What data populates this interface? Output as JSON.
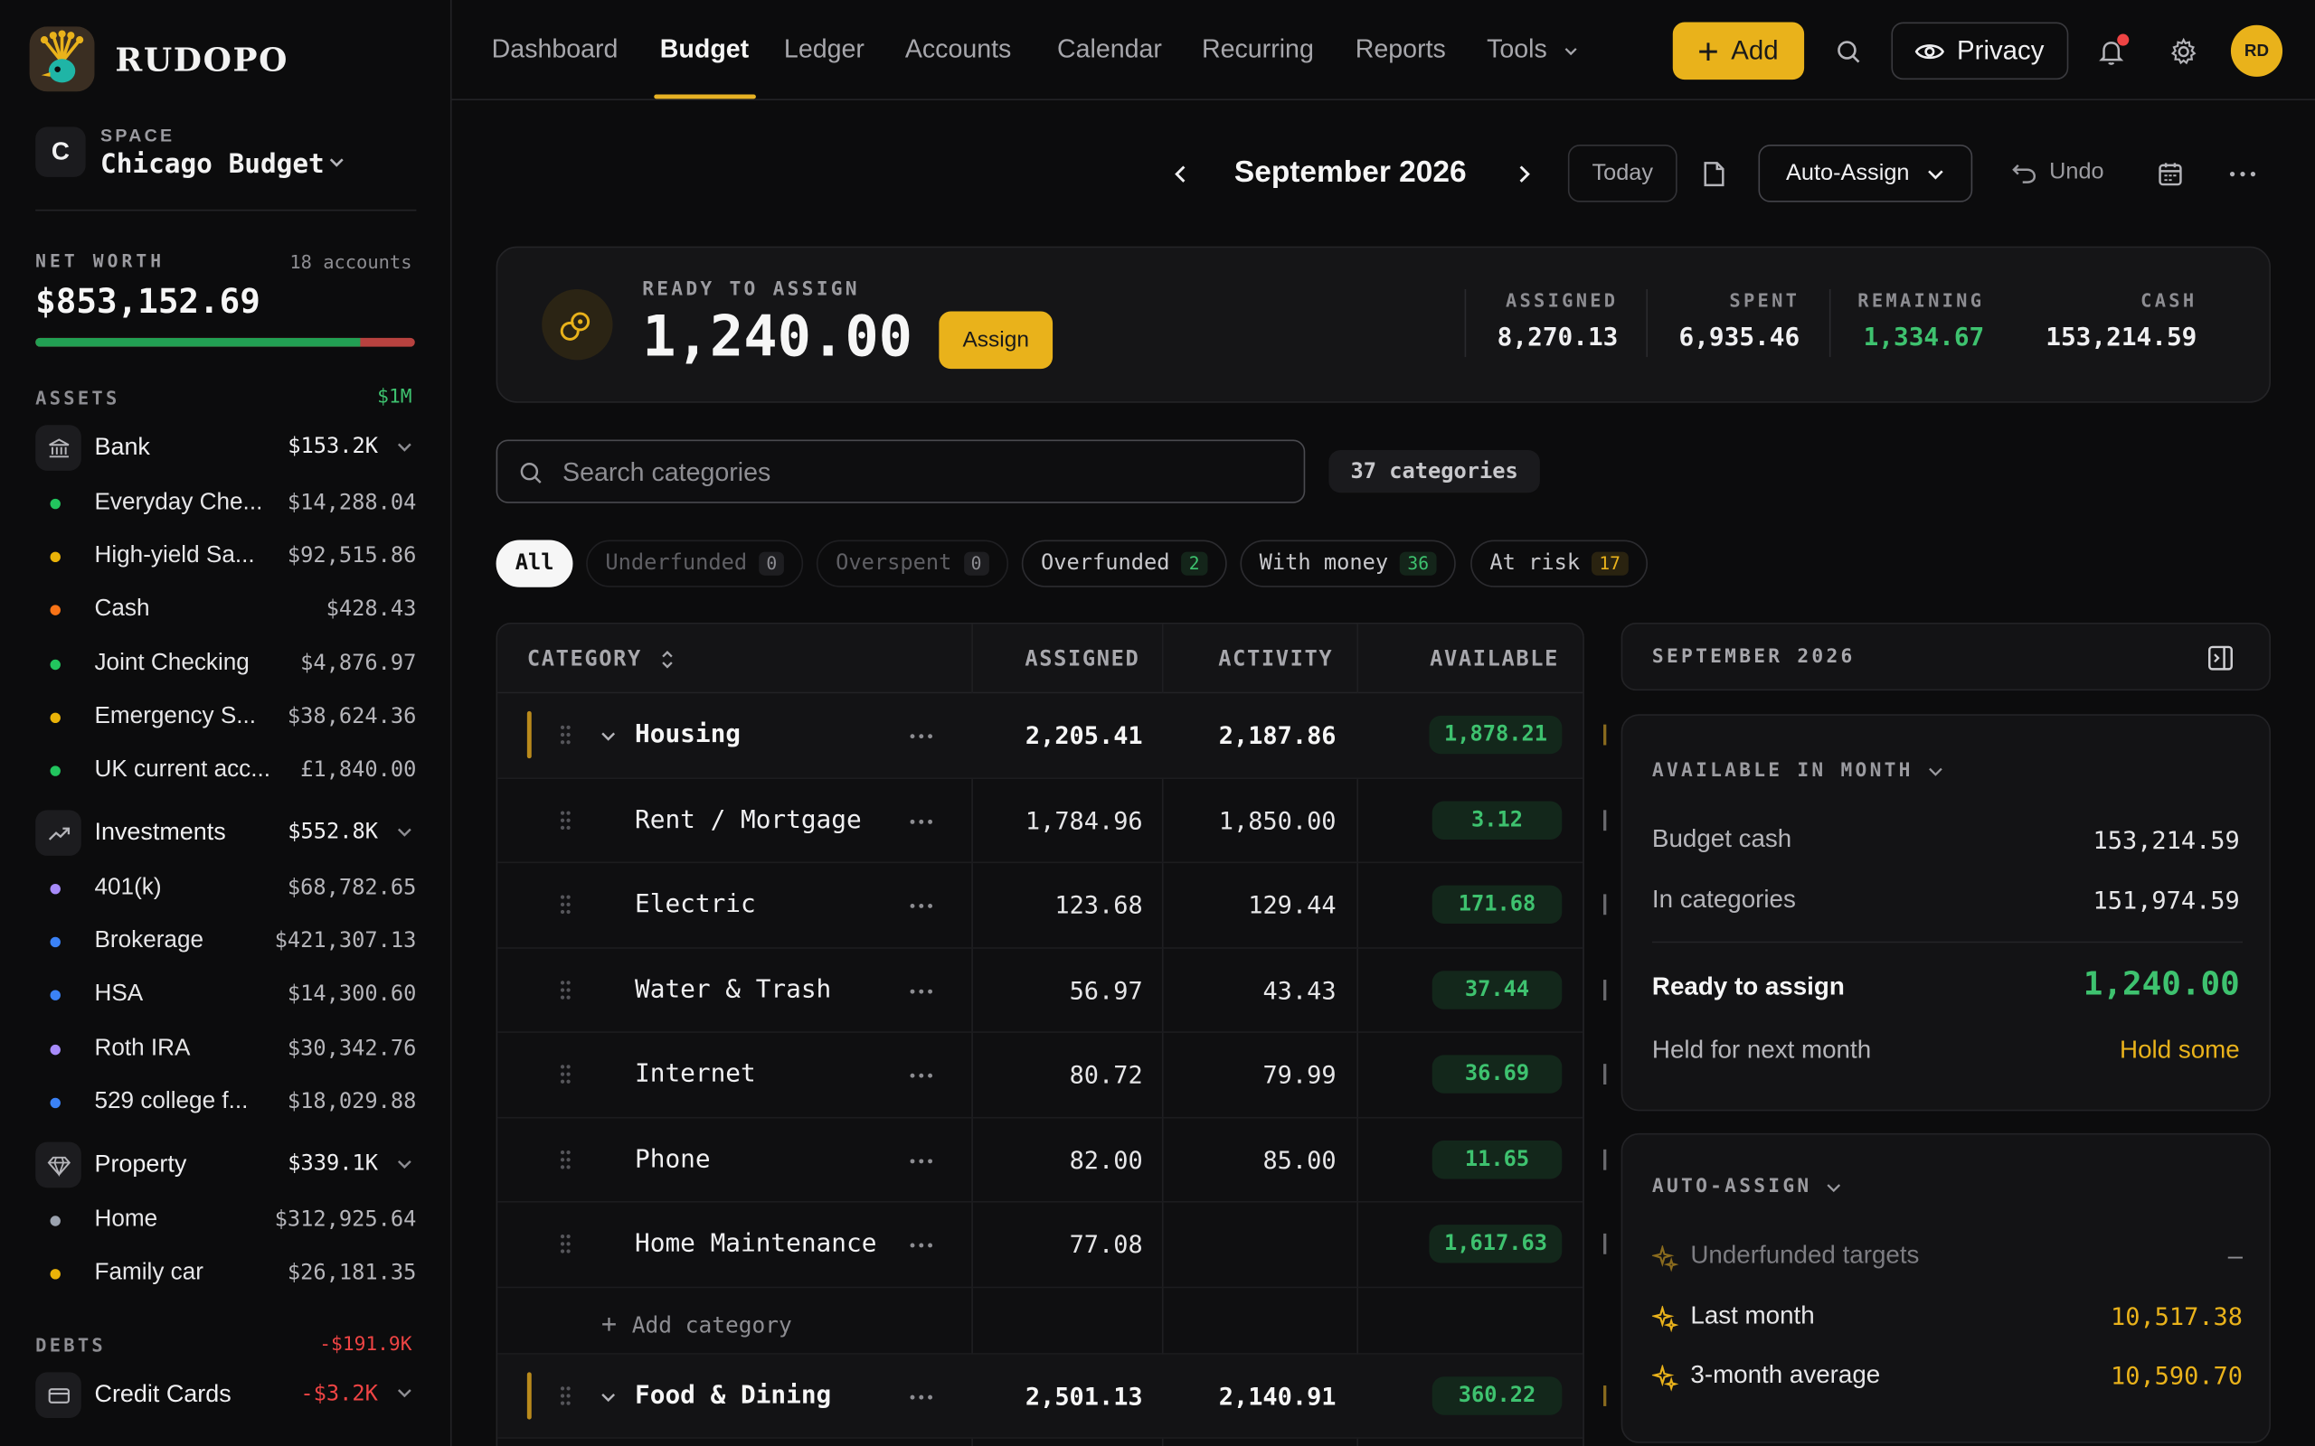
{
  "app": {
    "name": "RUDOPO"
  },
  "space": {
    "label": "SPACE",
    "initial": "C",
    "name": "Chicago Budget"
  },
  "net_worth": {
    "label": "NET WORTH",
    "accounts": "18 accounts",
    "value": "$853,152.69",
    "assets_fraction": 0.856
  },
  "assets": {
    "label": "ASSETS",
    "total": "$1M",
    "groups": [
      {
        "name": "Bank",
        "amount": "$153.2K",
        "icon": "bank-icon",
        "accounts": [
          {
            "name": "Everyday Che...",
            "amount": "$14,288.04",
            "color": "#22c55e"
          },
          {
            "name": "High-yield Sa...",
            "amount": "$92,515.86",
            "color": "#eab308"
          },
          {
            "name": "Cash",
            "amount": "$428.43",
            "color": "#f97316"
          },
          {
            "name": "Joint Checking",
            "amount": "$4,876.97",
            "color": "#22c55e"
          },
          {
            "name": "Emergency S...",
            "amount": "$38,624.36",
            "color": "#eab308"
          },
          {
            "name": "UK current acc...",
            "amount": "£1,840.00",
            "color": "#22c55e"
          }
        ]
      },
      {
        "name": "Investments",
        "amount": "$552.8K",
        "icon": "trending-up-icon",
        "accounts": [
          {
            "name": "401(k)",
            "amount": "$68,782.65",
            "color": "#a78bfa"
          },
          {
            "name": "Brokerage",
            "amount": "$421,307.13",
            "color": "#3b82f6"
          },
          {
            "name": "HSA",
            "amount": "$14,300.60",
            "color": "#3b82f6"
          },
          {
            "name": "Roth IRA",
            "amount": "$30,342.76",
            "color": "#a78bfa"
          },
          {
            "name": "529 college f...",
            "amount": "$18,029.88",
            "color": "#3b82f6"
          }
        ]
      },
      {
        "name": "Property",
        "amount": "$339.1K",
        "icon": "diamond-icon",
        "accounts": [
          {
            "name": "Home",
            "amount": "$312,925.64",
            "color": "#9ca3af"
          },
          {
            "name": "Family car",
            "amount": "$26,181.35",
            "color": "#eab308"
          }
        ]
      }
    ]
  },
  "debts": {
    "label": "DEBTS",
    "total": "-$191.9K",
    "groups": [
      {
        "name": "Credit Cards",
        "amount": "-$3.2K",
        "icon": "credit-card-icon"
      }
    ]
  },
  "nav": {
    "items": [
      "Dashboard",
      "Budget",
      "Ledger",
      "Accounts",
      "Calendar",
      "Recurring",
      "Reports",
      "Tools"
    ],
    "active": "Budget",
    "add_label": "Add",
    "privacy_label": "Privacy",
    "avatar": "RD"
  },
  "month_bar": {
    "month": "September 2026",
    "today": "Today",
    "auto_assign": "Auto-Assign",
    "undo": "Undo"
  },
  "ready": {
    "label": "READY TO ASSIGN",
    "value": "1,240.00",
    "assign_label": "Assign",
    "stats": [
      {
        "label": "ASSIGNED",
        "value": "8,270.13",
        "color": "#f0f0f2"
      },
      {
        "label": "SPENT",
        "value": "6,935.46",
        "color": "#f0f0f2"
      },
      {
        "label": "REMAINING",
        "value": "1,334.67",
        "color": "#3ec26f"
      },
      {
        "label": "CASH",
        "value": "153,214.59",
        "color": "#f0f0f2"
      }
    ]
  },
  "search": {
    "placeholder": "Search categories",
    "count": "37 categories"
  },
  "filters": [
    {
      "label": "All",
      "count": null,
      "state": "active"
    },
    {
      "label": "Underfunded",
      "count": "0",
      "state": "dim"
    },
    {
      "label": "Overspent",
      "count": "0",
      "state": "dim"
    },
    {
      "label": "Overfunded",
      "count": "2",
      "state": "green"
    },
    {
      "label": "With money",
      "count": "36",
      "state": "green"
    },
    {
      "label": "At risk",
      "count": "17",
      "state": "amber"
    }
  ],
  "table": {
    "headers": {
      "category": "CATEGORY",
      "assigned": "ASSIGNED",
      "activity": "ACTIVITY",
      "available": "AVAILABLE"
    },
    "rows": [
      {
        "type": "group",
        "name": "Housing",
        "assigned": "2,205.41",
        "activity": "2,187.86",
        "available": "1,878.21"
      },
      {
        "type": "item",
        "name": "Rent / Mortgage",
        "assigned": "1,784.96",
        "activity": "1,850.00",
        "available": "3.12"
      },
      {
        "type": "item",
        "name": "Electric",
        "assigned": "123.68",
        "activity": "129.44",
        "available": "171.68"
      },
      {
        "type": "item",
        "name": "Water & Trash",
        "assigned": "56.97",
        "activity": "43.43",
        "available": "37.44"
      },
      {
        "type": "item",
        "name": "Internet",
        "assigned": "80.72",
        "activity": "79.99",
        "available": "36.69"
      },
      {
        "type": "item",
        "name": "Phone",
        "assigned": "82.00",
        "activity": "85.00",
        "available": "11.65"
      },
      {
        "type": "item",
        "name": "Home Maintenance",
        "assigned": "77.08",
        "activity": "",
        "available": "1,617.63"
      },
      {
        "type": "add",
        "name": "Add category"
      },
      {
        "type": "group",
        "name": "Food & Dining",
        "assigned": "2,501.13",
        "activity": "2,140.91",
        "available": "360.22"
      }
    ]
  },
  "panel": {
    "title": "SEPTEMBER 2026",
    "available": {
      "title": "AVAILABLE IN MONTH",
      "budget_cash_label": "Budget cash",
      "budget_cash": "153,214.59",
      "in_categories_label": "In categories",
      "in_categories": "151,974.59",
      "ready_label": "Ready to assign",
      "ready": "1,240.00",
      "held_label": "Held for next month",
      "held": "Hold some"
    },
    "auto_assign": {
      "title": "AUTO-ASSIGN",
      "rows": [
        {
          "label": "Underfunded targets",
          "value": "–",
          "dim": true
        },
        {
          "label": "Last month",
          "value": "10,517.38",
          "dim": false
        },
        {
          "label": "3-month average",
          "value": "10,590.70",
          "dim": false
        }
      ]
    }
  }
}
